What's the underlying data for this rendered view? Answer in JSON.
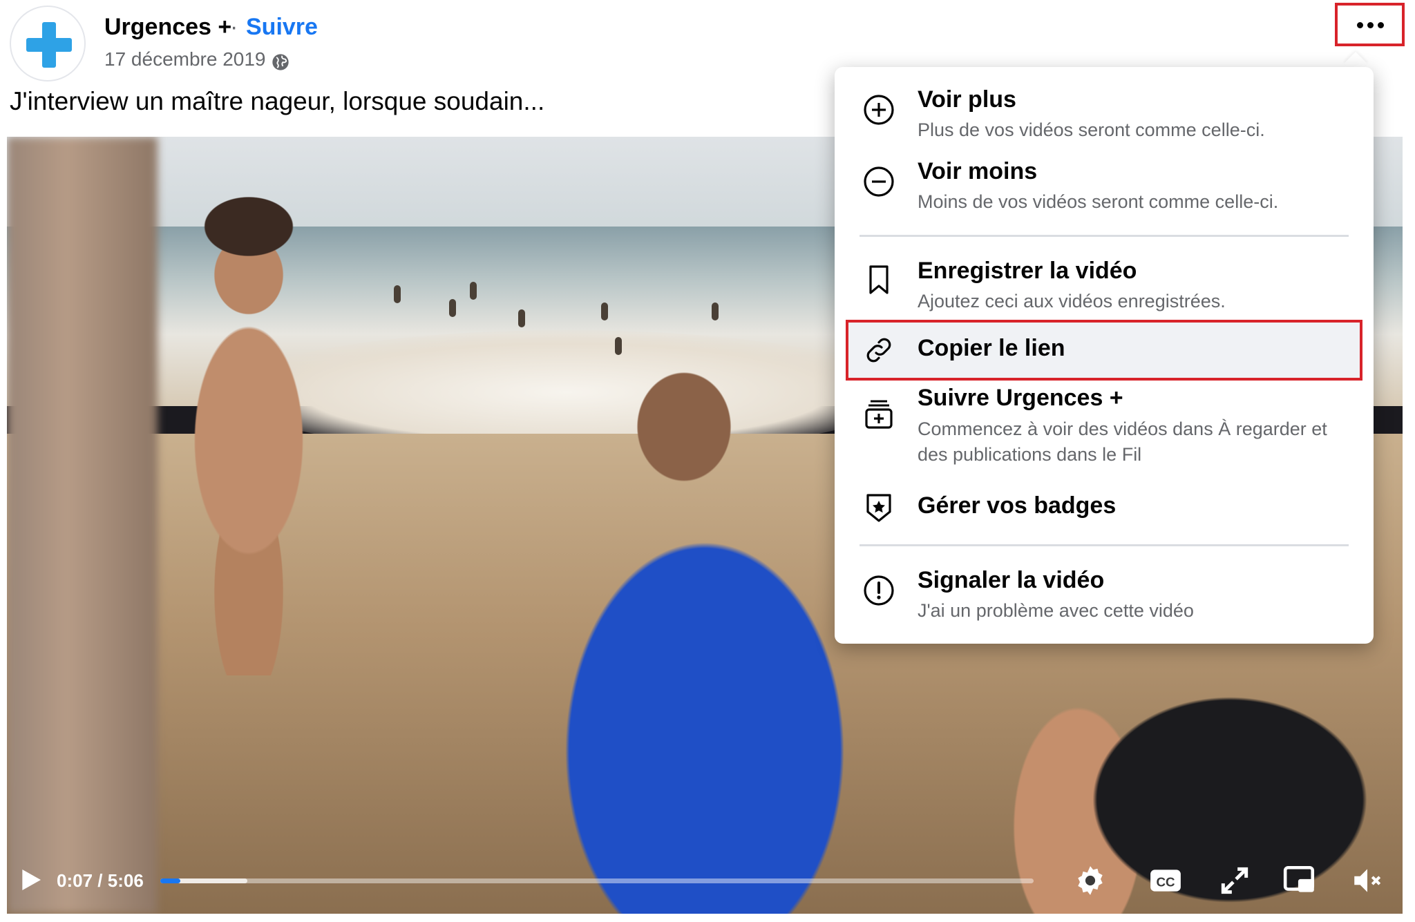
{
  "header": {
    "page_name": "Urgences +",
    "separator": "·",
    "follow_label": "Suivre",
    "date": "17 décembre 2019",
    "privacy_icon": "globe-icon",
    "more_icon": "more-horizontal-icon"
  },
  "post": {
    "text": "J'interview un maître nageur, lorsque soudain..."
  },
  "player": {
    "current_time": "0:07",
    "time_separator": "/",
    "duration": "5:06",
    "played_fraction": 0.023,
    "buffered_fraction": 0.1,
    "icons": [
      "play-icon",
      "settings-icon",
      "captions-icon",
      "fullscreen-icon",
      "picture-in-picture-icon",
      "volume-muted-icon"
    ]
  },
  "menu": {
    "items": [
      {
        "title": "Voir plus",
        "subtitle": "Plus de vos vidéos seront comme celle-ci.",
        "icon": "plus-circle-icon"
      },
      {
        "title": "Voir moins",
        "subtitle": "Moins de vos vidéos seront comme celle-ci.",
        "icon": "minus-circle-icon"
      },
      {
        "title": "Enregistrer la vidéo",
        "subtitle": "Ajoutez ceci aux vidéos enregistrées.",
        "icon": "bookmark-icon"
      },
      {
        "title": "Copier le lien",
        "subtitle": "",
        "icon": "link-icon",
        "highlighted": true
      },
      {
        "title": "Suivre Urgences +",
        "subtitle": "Commencez à voir des vidéos dans À regarder et des publications dans le Fil",
        "icon": "follow-stack-icon"
      },
      {
        "title": "Gérer vos badges",
        "subtitle": "",
        "icon": "badge-star-icon"
      },
      {
        "title": "Signaler la vidéo",
        "subtitle": "J'ai un problème avec cette vidéo",
        "icon": "report-icon"
      }
    ]
  },
  "colors": {
    "brand_blue": "#1877f2",
    "highlight_red": "#d8232a",
    "avatar_cross": "#2ea2e6",
    "secondary_text": "#65676b"
  }
}
